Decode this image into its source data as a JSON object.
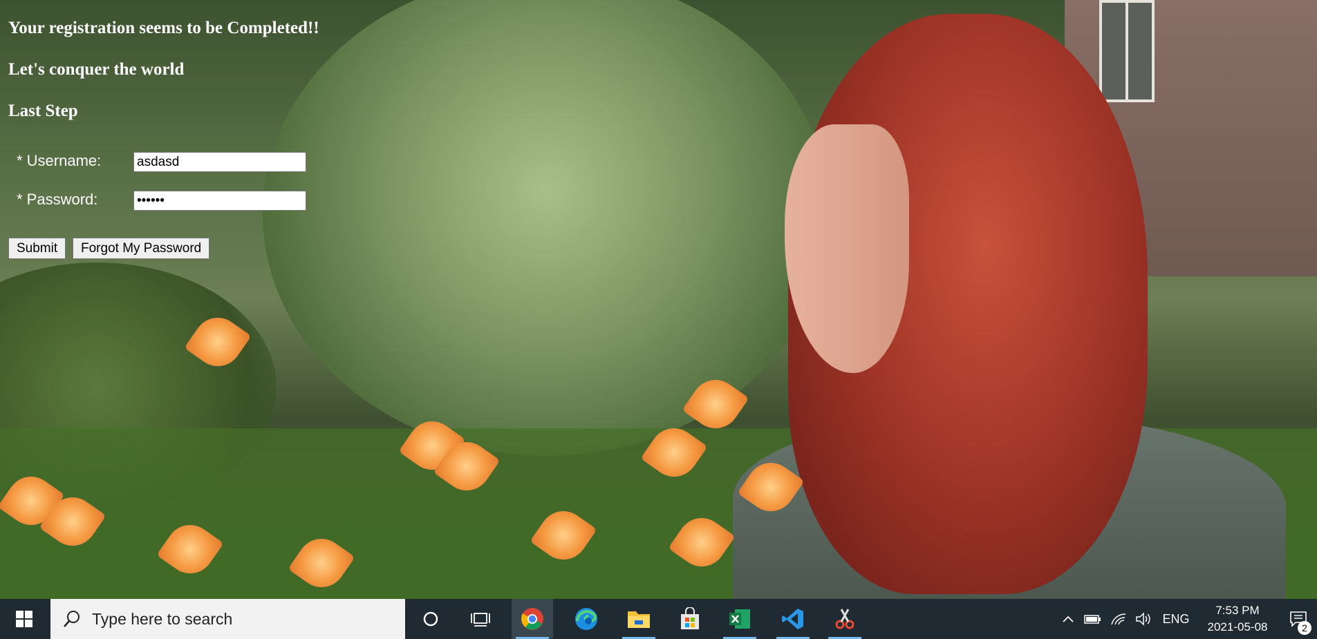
{
  "form": {
    "title": "Your registration seems to be Completed!!",
    "subtitle": "Let's conquer the world",
    "step_heading": "Last Step",
    "username_label": "* Username:",
    "username_value": "asdasd",
    "password_label": "* Password:",
    "password_value": "••••••",
    "submit_label": "Submit",
    "forgot_label": "Forgot My Password"
  },
  "taskbar": {
    "search_placeholder": "Type here to search",
    "apps": [
      "chrome-icon",
      "edge-icon",
      "file-explorer-icon",
      "store-icon",
      "excel-icon",
      "vscode-icon",
      "snipping-tool-icon"
    ],
    "language": "ENG",
    "time": "7:53 PM",
    "date": "2021-05-08",
    "notification_count": "2"
  },
  "colors": {
    "taskbar_bg": "#1f2a33",
    "active_app_underline": "#76b9ed"
  }
}
